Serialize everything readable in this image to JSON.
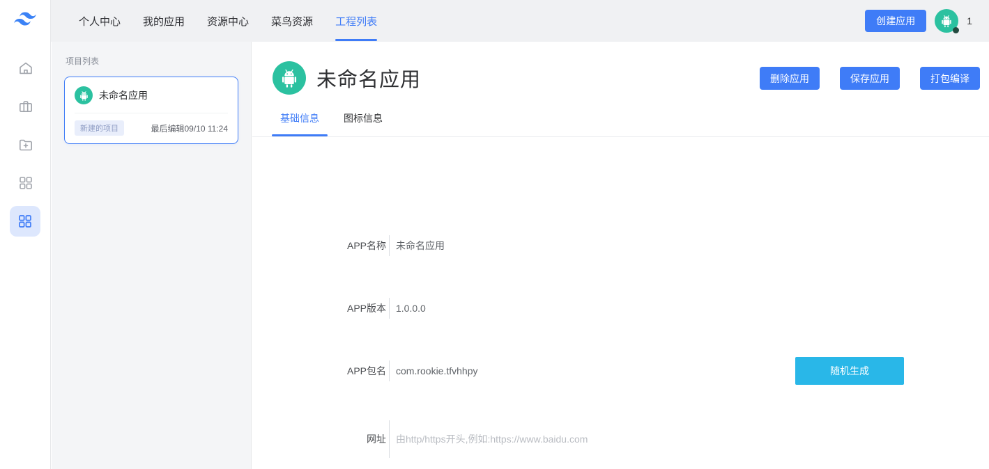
{
  "topnav": {
    "items": [
      {
        "label": "个人中心",
        "active": false
      },
      {
        "label": "我的应用",
        "active": false
      },
      {
        "label": "资源中心",
        "active": false
      },
      {
        "label": "菜鸟资源",
        "active": false
      },
      {
        "label": "工程列表",
        "active": true
      }
    ],
    "create_button": "创建应用",
    "avatar_icon": "android-robot-icon",
    "avatar_count": "1"
  },
  "sidebar": {
    "logo_icon": "wave-logo-icon",
    "items": [
      {
        "icon": "home-icon",
        "active": false
      },
      {
        "icon": "briefcase-icon",
        "active": false
      },
      {
        "icon": "folder-plus-icon",
        "active": false
      },
      {
        "icon": "grid-icon",
        "active": false
      },
      {
        "icon": "grid-icon",
        "active": true
      }
    ]
  },
  "project_panel": {
    "title": "项目列表",
    "card": {
      "icon": "android-robot-icon",
      "name": "未命名应用",
      "badge": "新建的项目",
      "last_edited": "最后编辑09/10 11:24"
    }
  },
  "main": {
    "app_icon": "android-robot-icon",
    "title": "未命名应用",
    "actions": {
      "delete": "删除应用",
      "save": "保存应用",
      "build": "打包编译"
    },
    "tabs": [
      {
        "label": "基础信息",
        "active": true
      },
      {
        "label": "图标信息",
        "active": false
      }
    ],
    "form": {
      "app_name": {
        "label": "APP名称",
        "value": "未命名应用"
      },
      "app_version": {
        "label": "APP版本",
        "value": "1.0.0.0"
      },
      "app_package": {
        "label": "APP包名",
        "value": "com.rookie.tfvhhpy",
        "button": "随机生成"
      },
      "website": {
        "label": "网址",
        "value": "",
        "placeholder": "由http/https开头,例如:https://www.baidu.com"
      }
    }
  },
  "colors": {
    "accent_blue": "#3f7cf7",
    "cyan_button": "#29b7e8",
    "icon_green": "#2bc1a0",
    "topbar_bg": "#f0f1f3",
    "panel_bg": "#f4f5f7"
  }
}
